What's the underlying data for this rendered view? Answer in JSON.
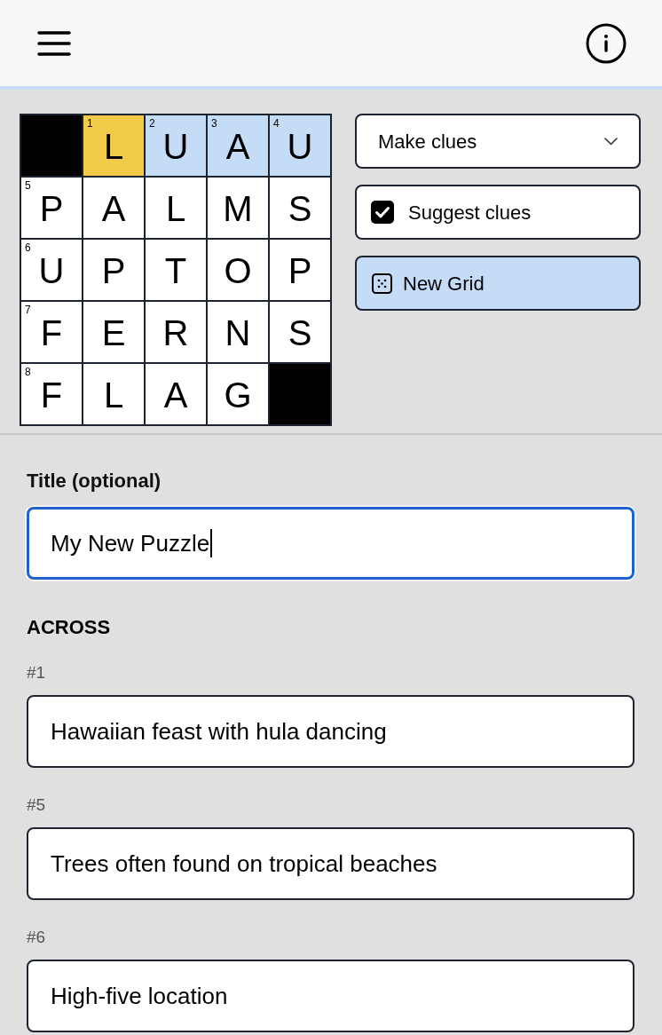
{
  "grid": {
    "rows": [
      [
        {
          "kind": "block"
        },
        {
          "kind": "letter",
          "number": "1",
          "letter": "L",
          "selected": true,
          "highlighted": false
        },
        {
          "kind": "letter",
          "number": "2",
          "letter": "U",
          "selected": false,
          "highlighted": true
        },
        {
          "kind": "letter",
          "number": "3",
          "letter": "A",
          "selected": false,
          "highlighted": true
        },
        {
          "kind": "letter",
          "number": "4",
          "letter": "U",
          "selected": false,
          "highlighted": true
        }
      ],
      [
        {
          "kind": "letter",
          "number": "5",
          "letter": "P",
          "selected": false,
          "highlighted": false
        },
        {
          "kind": "letter",
          "letter": "A",
          "selected": false,
          "highlighted": false
        },
        {
          "kind": "letter",
          "letter": "L",
          "selected": false,
          "highlighted": false
        },
        {
          "kind": "letter",
          "letter": "M",
          "selected": false,
          "highlighted": false
        },
        {
          "kind": "letter",
          "letter": "S",
          "selected": false,
          "highlighted": false
        }
      ],
      [
        {
          "kind": "letter",
          "number": "6",
          "letter": "U",
          "selected": false,
          "highlighted": false
        },
        {
          "kind": "letter",
          "letter": "P",
          "selected": false,
          "highlighted": false
        },
        {
          "kind": "letter",
          "letter": "T",
          "selected": false,
          "highlighted": false
        },
        {
          "kind": "letter",
          "letter": "O",
          "selected": false,
          "highlighted": false
        },
        {
          "kind": "letter",
          "letter": "P",
          "selected": false,
          "highlighted": false
        }
      ],
      [
        {
          "kind": "letter",
          "number": "7",
          "letter": "F",
          "selected": false,
          "highlighted": false
        },
        {
          "kind": "letter",
          "letter": "E",
          "selected": false,
          "highlighted": false
        },
        {
          "kind": "letter",
          "letter": "R",
          "selected": false,
          "highlighted": false
        },
        {
          "kind": "letter",
          "letter": "N",
          "selected": false,
          "highlighted": false
        },
        {
          "kind": "letter",
          "letter": "S",
          "selected": false,
          "highlighted": false
        }
      ],
      [
        {
          "kind": "letter",
          "number": "8",
          "letter": "F",
          "selected": false,
          "highlighted": false
        },
        {
          "kind": "letter",
          "letter": "L",
          "selected": false,
          "highlighted": false
        },
        {
          "kind": "letter",
          "letter": "A",
          "selected": false,
          "highlighted": false
        },
        {
          "kind": "letter",
          "letter": "G",
          "selected": false,
          "highlighted": false
        },
        {
          "kind": "block"
        }
      ]
    ]
  },
  "controls": {
    "mode_dropdown": {
      "value": "Make clues"
    },
    "suggest_clues": {
      "label": "Suggest clues",
      "checked": true
    },
    "new_grid_button": {
      "label": "New Grid"
    }
  },
  "title": {
    "label": "Title (optional)",
    "value": "My New Puzzle",
    "focused": true
  },
  "across": {
    "heading": "ACROSS",
    "clues": [
      {
        "number": "#1",
        "text": "Hawaiian feast with hula dancing"
      },
      {
        "number": "#5",
        "text": "Trees often found on tropical beaches"
      },
      {
        "number": "#6",
        "text": "High-five location"
      }
    ]
  }
}
